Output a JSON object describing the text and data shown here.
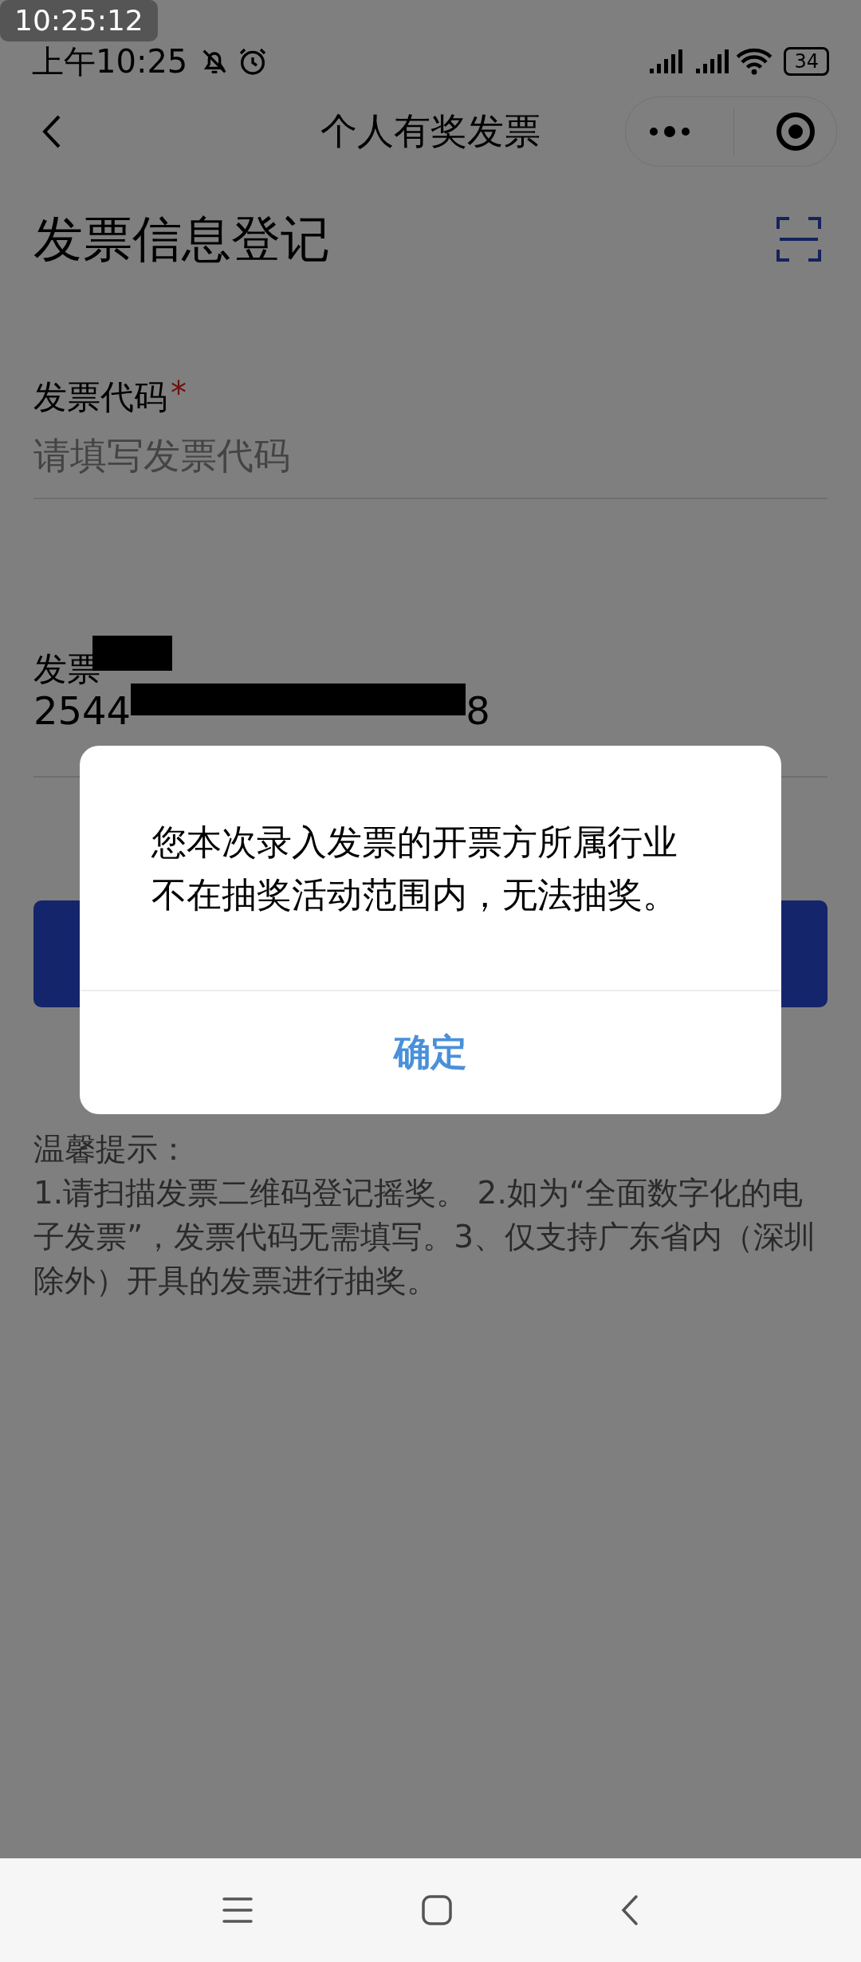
{
  "recorder_badge": "10:25:12",
  "status_bar": {
    "time": "上午10:25",
    "battery": "34"
  },
  "nav_bar": {
    "title": "个人有奖发票"
  },
  "page": {
    "heading": "发票信息登记",
    "fields": [
      {
        "label": "发票代码",
        "required_mark": "*",
        "placeholder": "请填写发票代码"
      },
      {
        "label": "发票",
        "value_parts": [
          "2544",
          "8"
        ],
        "redacted": true
      }
    ],
    "tips": {
      "title": "温馨提示：",
      "body": "1.请扫描发票二维码登记摇奖。 2.如为“全面数字化的电子发票”，发票代码无需填写。3、仅支持广东省内（深圳除外）开具的发票进行抽奖。"
    }
  },
  "dialog": {
    "message": "您本次录入发票的开票方所属行业不在抽奖活动范围内，无法抽奖。",
    "confirm": "确定"
  }
}
